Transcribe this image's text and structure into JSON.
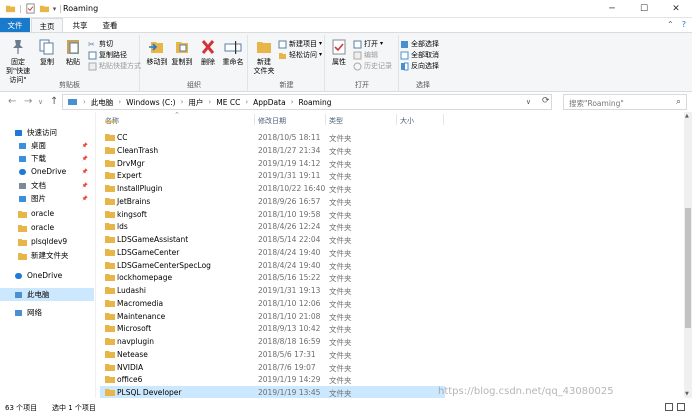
{
  "window": {
    "title": "Roaming"
  },
  "tabs": [
    "文件",
    "主页",
    "共享",
    "查看"
  ],
  "ribbon": {
    "clipboard": {
      "pin": "固定到\"快速访问\"",
      "copy": "复制",
      "paste": "粘贴",
      "cut": "剪切",
      "copy_path": "复制路径",
      "paste_shortcut": "粘贴快捷方式",
      "label": "剪贴板"
    },
    "organize": {
      "move_to": "移动到",
      "copy_to": "复制到",
      "delete": "删除",
      "rename": "重命名",
      "label": "组织"
    },
    "new": {
      "new_folder": "新建\n文件夹",
      "new_item": "新建项目",
      "easy_access": "轻松访问",
      "label": "新建"
    },
    "open": {
      "properties": "属性",
      "open": "打开",
      "edit": "编辑",
      "history": "历史记录",
      "label": "打开"
    },
    "select": {
      "select_all": "全部选择",
      "select_none": "全部取消",
      "invert": "反向选择",
      "label": "选择"
    }
  },
  "address": {
    "crumbs": [
      "此电脑",
      "Windows (C:)",
      "用户",
      "ME CC",
      "AppData",
      "Roaming"
    ],
    "search_placeholder": "搜索\"Roaming\""
  },
  "nav": {
    "items": [
      {
        "label": "快速访问",
        "icon": "star-icon",
        "pinned": false,
        "color": "#1e7ad6"
      },
      {
        "label": "桌面",
        "icon": "desktop-icon",
        "pinned": true,
        "color": "#3c8fd9"
      },
      {
        "label": "下载",
        "icon": "download-icon",
        "pinned": true,
        "color": "#3c8fd9"
      },
      {
        "label": "OneDrive",
        "icon": "cloud-icon",
        "pinned": true,
        "color": "#1e7ad6"
      },
      {
        "label": "文档",
        "icon": "document-icon",
        "pinned": true,
        "color": "#7a8a9a"
      },
      {
        "label": "图片",
        "icon": "picture-icon",
        "pinned": true,
        "color": "#3c8fd9"
      },
      {
        "label": "oracle",
        "icon": "folder-icon",
        "pinned": false,
        "color": "#e8b548"
      },
      {
        "label": "oracle",
        "icon": "folder-icon",
        "pinned": false,
        "color": "#e8b548"
      },
      {
        "label": "plsqldev9",
        "icon": "folder-icon",
        "pinned": false,
        "color": "#e8b548"
      },
      {
        "label": "新建文件夹",
        "icon": "folder-icon",
        "pinned": false,
        "color": "#e8b548"
      },
      {
        "label": "OneDrive",
        "icon": "cloud-icon",
        "pinned": false,
        "color": "#1e7ad6"
      },
      {
        "label": "此电脑",
        "icon": "computer-icon",
        "pinned": false,
        "color": "#4a90d0"
      },
      {
        "label": "网络",
        "icon": "network-icon",
        "pinned": false,
        "color": "#4a90d0"
      }
    ]
  },
  "columns": {
    "name": "名称",
    "date": "修改日期",
    "type": "类型",
    "size": "大小"
  },
  "files": [
    {
      "name": "CC",
      "date": "2018/10/5 18:11",
      "type": "文件夹"
    },
    {
      "name": "CleanTrash",
      "date": "2018/1/27 21:34",
      "type": "文件夹"
    },
    {
      "name": "DrvMgr",
      "date": "2019/1/19 14:12",
      "type": "文件夹"
    },
    {
      "name": "Expert",
      "date": "2019/1/31 19:11",
      "type": "文件夹"
    },
    {
      "name": "InstallPlugin",
      "date": "2018/10/22 16:40",
      "type": "文件夹"
    },
    {
      "name": "JetBrains",
      "date": "2018/9/26 16:57",
      "type": "文件夹"
    },
    {
      "name": "kingsoft",
      "date": "2018/1/10 19:58",
      "type": "文件夹"
    },
    {
      "name": "lds",
      "date": "2018/4/26 12:24",
      "type": "文件夹"
    },
    {
      "name": "LDSGameAssistant",
      "date": "2018/5/14 22:04",
      "type": "文件夹"
    },
    {
      "name": "LDSGameCenter",
      "date": "2018/4/24 19:40",
      "type": "文件夹"
    },
    {
      "name": "LDSGameCenterSpecLog",
      "date": "2018/4/24 19:40",
      "type": "文件夹"
    },
    {
      "name": "lockhomepage",
      "date": "2018/5/16 15:22",
      "type": "文件夹"
    },
    {
      "name": "Ludashi",
      "date": "2019/1/31 19:13",
      "type": "文件夹"
    },
    {
      "name": "Macromedia",
      "date": "2018/1/10 12:06",
      "type": "文件夹"
    },
    {
      "name": "Maintenance",
      "date": "2018/1/10 21:08",
      "type": "文件夹"
    },
    {
      "name": "Microsoft",
      "date": "2018/9/13 10:42",
      "type": "文件夹"
    },
    {
      "name": "navplugin",
      "date": "2018/8/18 16:59",
      "type": "文件夹"
    },
    {
      "name": "Netease",
      "date": "2018/5/6 17:31",
      "type": "文件夹"
    },
    {
      "name": "NVIDIA",
      "date": "2018/7/6 19:07",
      "type": "文件夹"
    },
    {
      "name": "office6",
      "date": "2019/1/19 14:29",
      "type": "文件夹"
    },
    {
      "name": "PLSQL Developer",
      "date": "2019/1/19 13:45",
      "type": "文件夹",
      "selected": true
    }
  ],
  "status": {
    "count": "63 个项目",
    "selected": "选中 1 个项目"
  },
  "watermark": "https://blog.csdn.net/qq_43080025"
}
